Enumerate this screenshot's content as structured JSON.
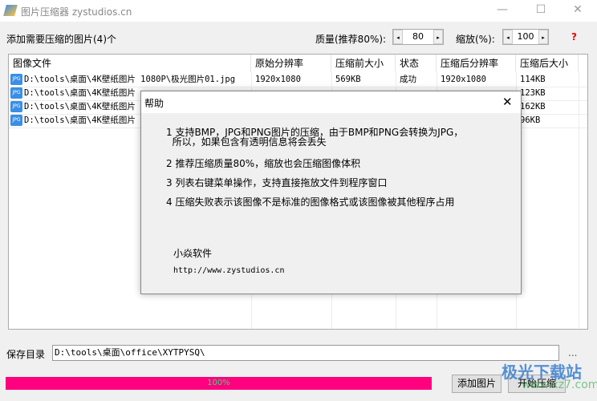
{
  "window": {
    "title": "图片压缩器 zystudios.cn",
    "minimize": "—",
    "maximize": "☐",
    "close": "✕"
  },
  "toolbar": {
    "count_label": "添加需要压缩的图片(4)个",
    "quality_label": "质量(推荐80%):",
    "quality_value": "80",
    "scale_label": "缩放(%):",
    "scale_value": "100",
    "help": "?",
    "left_arrow": "◂",
    "right_arrow": "▸"
  },
  "table": {
    "headers": [
      "图像文件",
      "原始分辨率",
      "压缩前大小",
      "状态",
      "压缩后分辨率",
      "压缩后大小"
    ],
    "icon_label": "JPG",
    "rows": [
      {
        "file": "D:\\tools\\桌面\\4K壁纸图片 1080P\\极光图片01.jpg",
        "orig_res": "1920x1080",
        "orig_size": "569KB",
        "status": "成功",
        "new_res": "1920x1080",
        "new_size": "114KB"
      },
      {
        "file": "D:\\tools\\桌面\\4K壁纸图片",
        "orig_res": "",
        "orig_size": "",
        "status": "",
        "new_res": "",
        "new_size": "123KB"
      },
      {
        "file": "D:\\tools\\桌面\\4K壁纸图片",
        "orig_res": "",
        "orig_size": "",
        "status": "",
        "new_res": "",
        "new_size": "162KB"
      },
      {
        "file": "D:\\tools\\桌面\\4K壁纸图片",
        "orig_res": "",
        "orig_size": "",
        "status": "",
        "new_res": "",
        "new_size": "96KB"
      }
    ]
  },
  "dialog": {
    "title": "帮助",
    "close": "✕",
    "lines": [
      "1 支持BMP，JPG和PNG图片的压缩，由于BMP和PNG会转换为JPG，",
      "  所以，如果包含有透明信息将会丢失",
      "2 推荐压缩质量80%，缩放也会压缩图像体积",
      "3 列表右键菜单操作，支持直接拖放文件到程序窗口",
      "4 压缩失败表示该图像不是标准的图像格式或该图像被其他程序占用"
    ],
    "company": "小焱软件",
    "url": "http://www.zystudios.cn"
  },
  "bottom": {
    "save_label": "保存目录",
    "save_path": "D:\\tools\\桌面\\office\\XYTPYSQ\\",
    "browse": "...",
    "progress_text": "100%",
    "progress": 1.0,
    "add_button": "添加图片",
    "start_button": "开始压缩"
  },
  "watermark": {
    "text": "极光下载站",
    "url": "www.xz7.com"
  }
}
